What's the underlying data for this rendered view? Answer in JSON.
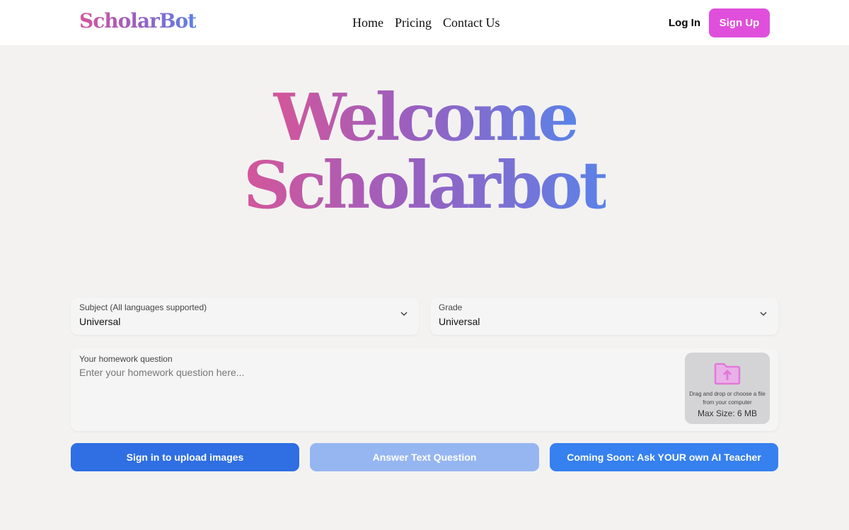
{
  "header": {
    "logo": "ScholarBot",
    "nav": [
      "Home",
      "Pricing",
      "Contact Us"
    ],
    "login": "Log In",
    "signup": "Sign Up"
  },
  "hero": {
    "line1": "Welcome",
    "line2": "Scholarbot"
  },
  "form": {
    "subject": {
      "label": "Subject (All languages supported)",
      "value": "Universal"
    },
    "grade": {
      "label": "Grade",
      "value": "Universal"
    },
    "question": {
      "label": "Your homework question",
      "placeholder": "Enter your homework question here...",
      "value": ""
    },
    "upload": {
      "icon": "folder-upload-icon",
      "hint": "Drag and drop or choose a file from your computer",
      "max_size": "Max Size: 6 MB"
    }
  },
  "actions": {
    "upload_images": "Sign in to upload images",
    "answer_text": "Answer Text Question",
    "ai_teacher": "Coming Soon: Ask YOUR own AI Teacher"
  },
  "colors": {
    "brand_pink": "#e04fdc",
    "primary_blue": "#2f6ee3",
    "disabled_blue": "#96b6f1",
    "accent_blue": "#3680f0"
  }
}
